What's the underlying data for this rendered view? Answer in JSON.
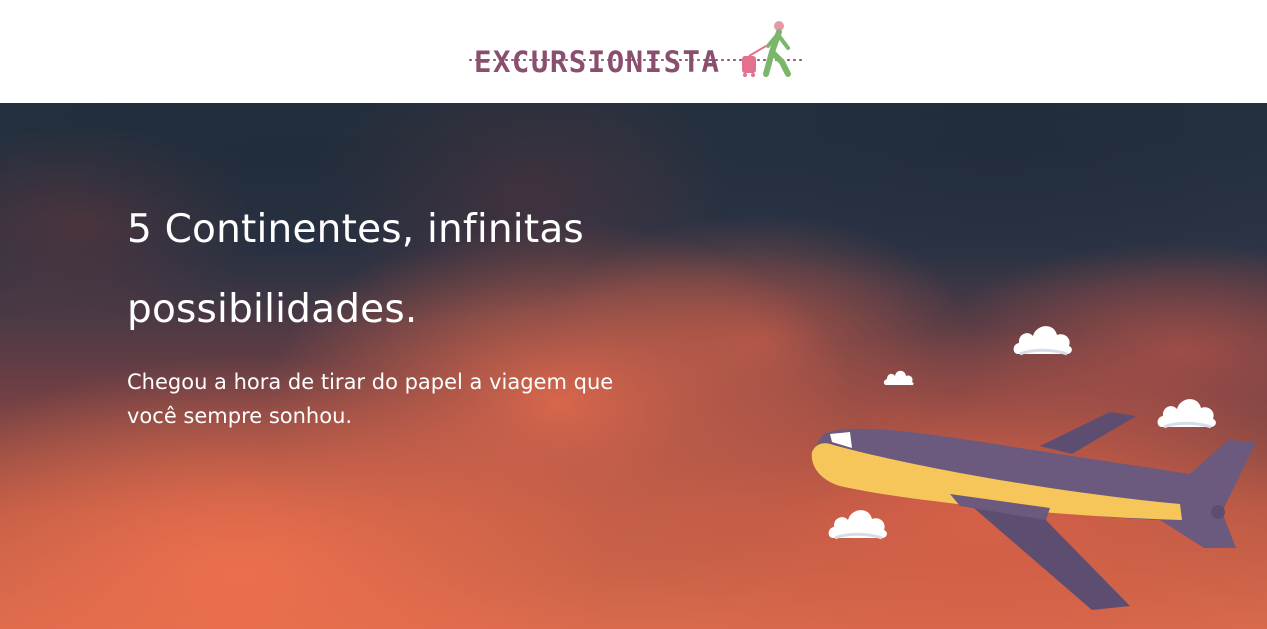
{
  "header": {
    "logo_text": "EXCURSIONISTA"
  },
  "hero": {
    "title": "5 Continentes, infinitas possibilidades.",
    "subtitle": "Chegou a hora de tirar do papel a viagem que você sempre sonhou."
  },
  "colors": {
    "logo_text": "#8a4f6e",
    "logo_figure": "#7cb66a",
    "plane_body": "#6b5a7e",
    "plane_stripe": "#f7c65a",
    "cloud": "#ffffff",
    "hero_text": "#ffffff"
  },
  "icons": {
    "logo_figure": "walking-traveler-with-suitcase-icon",
    "plane": "airplane-illustration",
    "cloud": "cloud-icon"
  }
}
